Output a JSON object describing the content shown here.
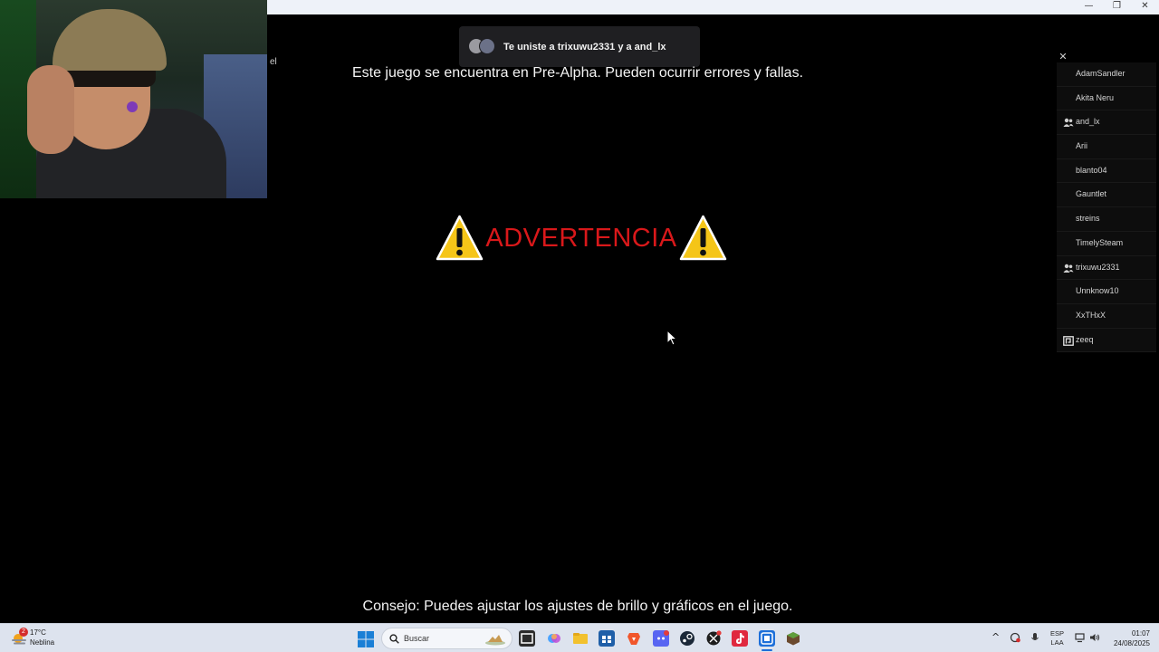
{
  "window": {
    "minimize_glyph": "—",
    "restore_glyph": "❐",
    "close_glyph": "✕"
  },
  "side_text": "el",
  "toast": {
    "message": "Te uniste a trixuwu2331 y a and_lx"
  },
  "game": {
    "prealpha_notice": "Este juego se encuentra en Pre-Alpha. Pueden ocurrir errores y fallas.",
    "warning_title": "ADVERTENCIA",
    "tip": "Consejo: Puedes ajustar los ajustes de brillo y gráficos en el juego."
  },
  "players_panel": {
    "close_glyph": "✕",
    "players": [
      {
        "name": "AdamSandler",
        "icon": "none"
      },
      {
        "name": "Akita Neru",
        "icon": "none"
      },
      {
        "name": "and_lx",
        "icon": "friends-icon"
      },
      {
        "name": "Arii",
        "icon": "none"
      },
      {
        "name": "blanto04",
        "icon": "none"
      },
      {
        "name": "Gauntlet",
        "icon": "none"
      },
      {
        "name": "streins",
        "icon": "none"
      },
      {
        "name": "TimelySteam",
        "icon": "none"
      },
      {
        "name": "trixuwu2331",
        "icon": "friends-icon"
      },
      {
        "name": "Unnknow10",
        "icon": "none"
      },
      {
        "name": "XxTHxX",
        "icon": "none"
      },
      {
        "name": "zeeq",
        "icon": "platform-icon"
      }
    ]
  },
  "taskbar": {
    "weather": {
      "badge": "2",
      "temp": "17°C",
      "condition": "Neblina"
    },
    "search_placeholder": "Buscar",
    "apps": [
      "task-view-icon",
      "copilot-icon",
      "file-explorer-icon",
      "store-icon",
      "brave-icon",
      "discord-icon",
      "steam-icon",
      "xbox-icon",
      "tiktok-icon",
      "game-launcher-icon",
      "minecraft-icon"
    ],
    "tray": {
      "chevron": "^",
      "lang_line1": "ESP",
      "lang_line2": "LAA",
      "time": "01:07",
      "date": "24/08/2025"
    }
  },
  "colors": {
    "warning_red": "#d9181a",
    "warning_yellow": "#f5c518",
    "taskbar": "#dde3ee"
  }
}
